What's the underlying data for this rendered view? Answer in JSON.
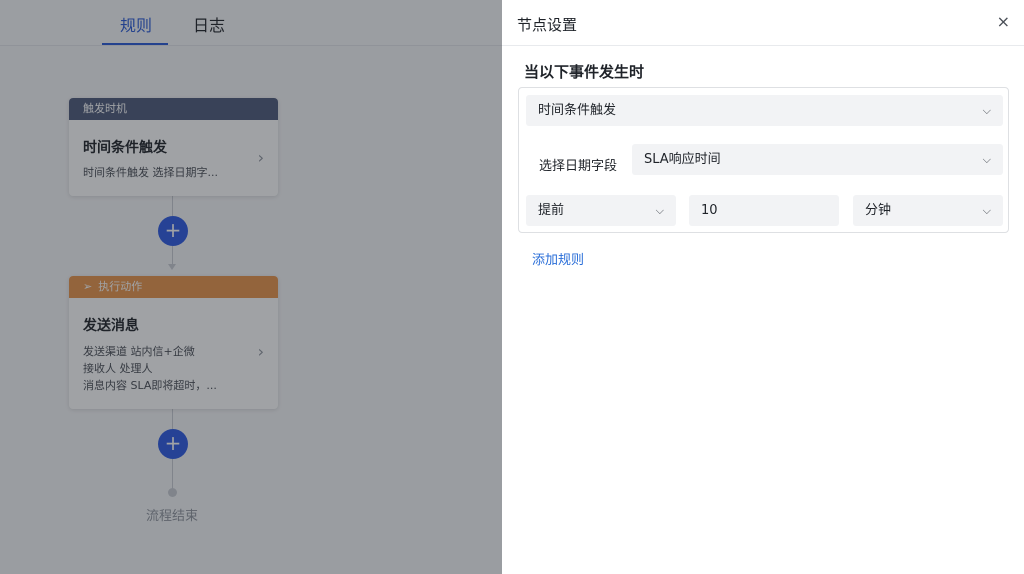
{
  "nav": {
    "tabs": [
      "规则",
      "日志"
    ]
  },
  "flow": {
    "trigger_card": {
      "header": "触发时机",
      "title": "时间条件触发",
      "desc": "时间条件触发 选择日期字..."
    },
    "action_card": {
      "header": "执行动作",
      "title": "发送消息",
      "lines": [
        "发送渠道 站内信+企微",
        "接收人 处理人",
        "消息内容 SLA即将超时，..."
      ]
    },
    "end_label": "流程结束"
  },
  "drawer": {
    "title": "节点设置",
    "close": "×",
    "section_title": "当以下事件发生时",
    "trigger_type": "时间条件触发",
    "date_field_label": "选择日期字段",
    "date_field_value": "SLA响应时间",
    "offset_direction": "提前",
    "offset_value": "10",
    "offset_unit": "分钟",
    "add_rule": "添加规则"
  },
  "colors": {
    "primary": "#2d5be3",
    "trigger_header": "#4e5a7a",
    "action_header": "#e9954a",
    "link": "#2a6ed8"
  }
}
